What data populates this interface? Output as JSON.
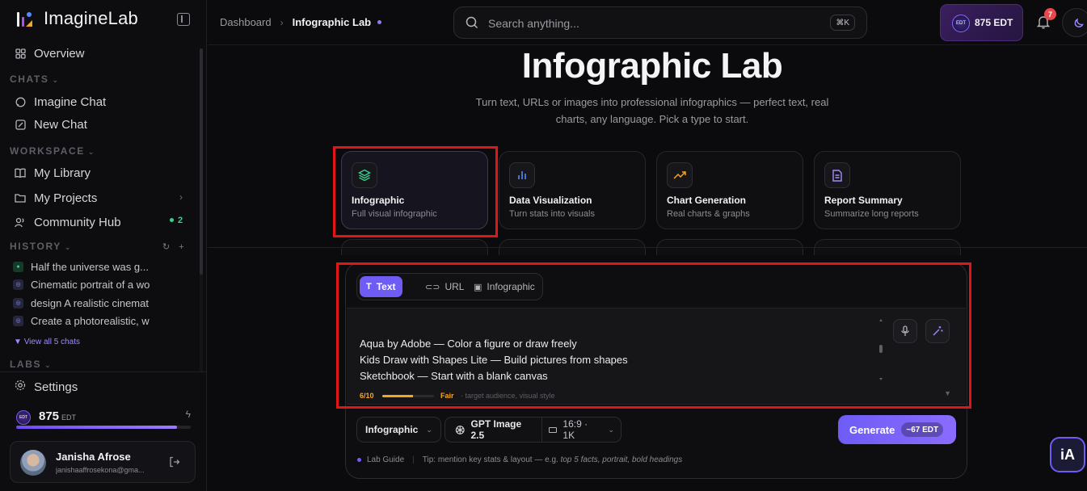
{
  "app": {
    "name": "ImagineLab"
  },
  "sidebar": {
    "overview": "Overview",
    "chats_label": "CHATS",
    "chats": [
      "Imagine Chat",
      "New Chat"
    ],
    "workspace_label": "WORKSPACE",
    "workspace": [
      "My Library",
      "My Projects",
      "Community Hub"
    ],
    "community_count": "2",
    "history_label": "HISTORY",
    "history": [
      "Half the universe was g...",
      "Cinematic portrait of a wo",
      "design A realistic cinemat",
      "Create a photorealistic, w"
    ],
    "view_all": "View all 5 chats",
    "labs_label": "LABS",
    "settings": "Settings",
    "credits": {
      "value": "875",
      "unit": "EDT",
      "fraction": 0.92
    },
    "user": {
      "name": "Janisha Afrose",
      "email": "janishaaffrosekona@gma..."
    }
  },
  "topbar": {
    "breadcrumb": [
      "Dashboard",
      "Infographic Lab"
    ],
    "search_placeholder": "Search anything...",
    "shortcut": "⌘K",
    "edt_balance": "875 EDT",
    "notifications": "7"
  },
  "hero": {
    "title": "Infographic Lab",
    "subtitle": "Turn text, URLs or images into professional infographics — perfect text, real charts, any language. Pick a type to start."
  },
  "types": [
    {
      "title": "Infographic",
      "subtitle": "Full visual infographic",
      "icon": "layers-icon",
      "color": "#3ecf8e"
    },
    {
      "title": "Data Visualization",
      "subtitle": "Turn stats into visuals",
      "icon": "bar-chart-icon",
      "color": "#4f8cff"
    },
    {
      "title": "Chart Generation",
      "subtitle": "Real charts & graphs",
      "icon": "trend-icon",
      "color": "#f5a524"
    },
    {
      "title": "Report Summary",
      "subtitle": "Summarize long reports",
      "icon": "document-icon",
      "color": "#a78bfa"
    }
  ],
  "composer": {
    "tabs": [
      "Text",
      "URL",
      "Infographic"
    ],
    "lines": [
      "Aqua by Adobe — Color a figure or draw freely",
      "Kids Draw with Shapes Lite — Build pictures from shapes",
      "Sketchbook — Start with a blank canvas"
    ],
    "score": "6/10",
    "score_fraction": 0.6,
    "score_label": "Fair",
    "score_hint": "· target audience, visual style",
    "type_select": "Infographic",
    "model": "GPT Image 2.5",
    "ratio": "16:9 · 1K",
    "generate": "Generate",
    "cost": "~67 EDT",
    "guide": "Lab Guide",
    "tip_prefix": "Tip: mention key stats & layout — e.g.",
    "tip_example": "top 5 facts, portrait, bold headings"
  },
  "colors": {
    "accent": "#6e5cf5",
    "highlight": "#e01515",
    "warning": "#f5a524",
    "success": "#3ecf8e"
  }
}
